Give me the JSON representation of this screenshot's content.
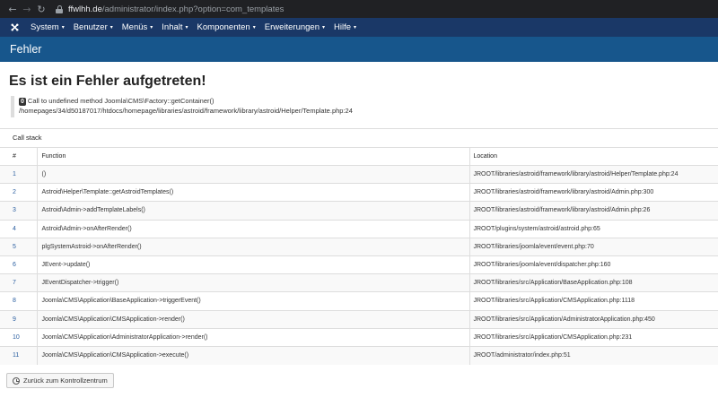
{
  "browser": {
    "back_icon": "arrow-left-icon",
    "forward_icon": "arrow-right-icon",
    "refresh_icon": "reload-icon",
    "back_glyph": "←",
    "forward_glyph": "→",
    "refresh_glyph": "↻",
    "url_host": "ffwlhh.de",
    "url_path": "/administrator/index.php?option=com_templates"
  },
  "nav": {
    "logo_icon": "joomla-logo-icon",
    "items": [
      {
        "label": "System"
      },
      {
        "label": "Benutzer"
      },
      {
        "label": "Menüs"
      },
      {
        "label": "Inhalt"
      },
      {
        "label": "Komponenten"
      },
      {
        "label": "Erweiterungen"
      },
      {
        "label": "Hilfe"
      }
    ],
    "caret": "▾"
  },
  "subhead": {
    "title": "Fehler"
  },
  "error": {
    "heading": "Es ist ein Fehler aufgetreten!",
    "code": "0",
    "message": "Call to undefined method Joomla\\CMS\\Factory::getContainer()",
    "file": "/homepages/34/d50187017/htdocs/homepage/libraries/astroid/framework/library/astroid/Helper/Template.php:24"
  },
  "call_stack": {
    "caption": "Call stack",
    "headers": [
      "#",
      "Function",
      "Location"
    ],
    "rows": [
      {
        "num": "1",
        "function": "()",
        "location": "JROOT/libraries/astroid/framework/library/astroid/Helper/Template.php:24"
      },
      {
        "num": "2",
        "function": "Astroid\\Helper\\Template::getAstroidTemplates()",
        "location": "JROOT/libraries/astroid/framework/library/astroid/Admin.php:300"
      },
      {
        "num": "3",
        "function": "Astroid\\Admin->addTemplateLabels()",
        "location": "JROOT/libraries/astroid/framework/library/astroid/Admin.php:26"
      },
      {
        "num": "4",
        "function": "Astroid\\Admin->onAfterRender()",
        "location": "JROOT/plugins/system/astroid/astroid.php:65"
      },
      {
        "num": "5",
        "function": "plgSystemAstroid->onAfterRender()",
        "location": "JROOT/libraries/joomla/event/event.php:70"
      },
      {
        "num": "6",
        "function": "JEvent->update()",
        "location": "JROOT/libraries/joomla/event/dispatcher.php:160"
      },
      {
        "num": "7",
        "function": "JEventDispatcher->trigger()",
        "location": "JROOT/libraries/src/Application/BaseApplication.php:108"
      },
      {
        "num": "8",
        "function": "Joomla\\CMS\\Application\\BaseApplication->triggerEvent()",
        "location": "JROOT/libraries/src/Application/CMSApplication.php:1118"
      },
      {
        "num": "9",
        "function": "Joomla\\CMS\\Application\\CMSApplication->render()",
        "location": "JROOT/libraries/src/Application/AdministratorApplication.php:450"
      },
      {
        "num": "10",
        "function": "Joomla\\CMS\\Application\\AdministratorApplication->render()",
        "location": "JROOT/libraries/src/Application/CMSApplication.php:231"
      },
      {
        "num": "11",
        "function": "Joomla\\CMS\\Application\\CMSApplication->execute()",
        "location": "JROOT/administrator/index.php:51"
      }
    ]
  },
  "back_button": {
    "label": "Zurück zum Kontrollzentrum",
    "icon": "dashboard-icon"
  },
  "colors": {
    "nav_bg": "#1a3867",
    "subhead_bg": "#17568c",
    "chrome_bg": "#202124",
    "link": "#2a5ea0"
  }
}
